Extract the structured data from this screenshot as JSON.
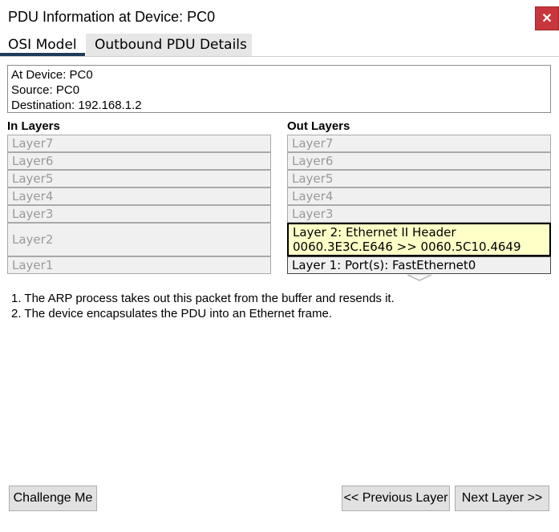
{
  "window": {
    "title": "PDU Information at Device: PC0",
    "close_glyph": "✕"
  },
  "tabs": [
    {
      "label": "OSI Model",
      "active": true
    },
    {
      "label": "Outbound PDU Details",
      "active": false
    }
  ],
  "info": {
    "device": "At Device: PC0",
    "source": "Source: PC0",
    "destination": "Destination: 192.168.1.2"
  },
  "in_layers": {
    "heading": "In Layers",
    "items": [
      "Layer7",
      "Layer6",
      "Layer5",
      "Layer4",
      "Layer3",
      "Layer2",
      "Layer1"
    ]
  },
  "out_layers": {
    "heading": "Out Layers",
    "items": [
      "Layer7",
      "Layer6",
      "Layer5",
      "Layer4",
      "Layer3"
    ],
    "layer2_line1": "Layer 2: Ethernet II Header",
    "layer2_line2": "0060.3E3C.E646 >> 0060.5C10.4649",
    "layer1": "Layer 1: Port(s): FastEthernet0"
  },
  "notes": [
    "1. The ARP process takes out this packet from the buffer and resends it.",
    "2. The device encapsulates the PDU into an Ethernet frame."
  ],
  "buttons": {
    "challenge": "Challenge Me",
    "previous": "<< Previous Layer",
    "next": "Next Layer >>"
  },
  "colors": {
    "close_bg": "#c9353c",
    "active_layer_bg": "#ffffc8",
    "tab_underline": "#1f3a5a"
  }
}
